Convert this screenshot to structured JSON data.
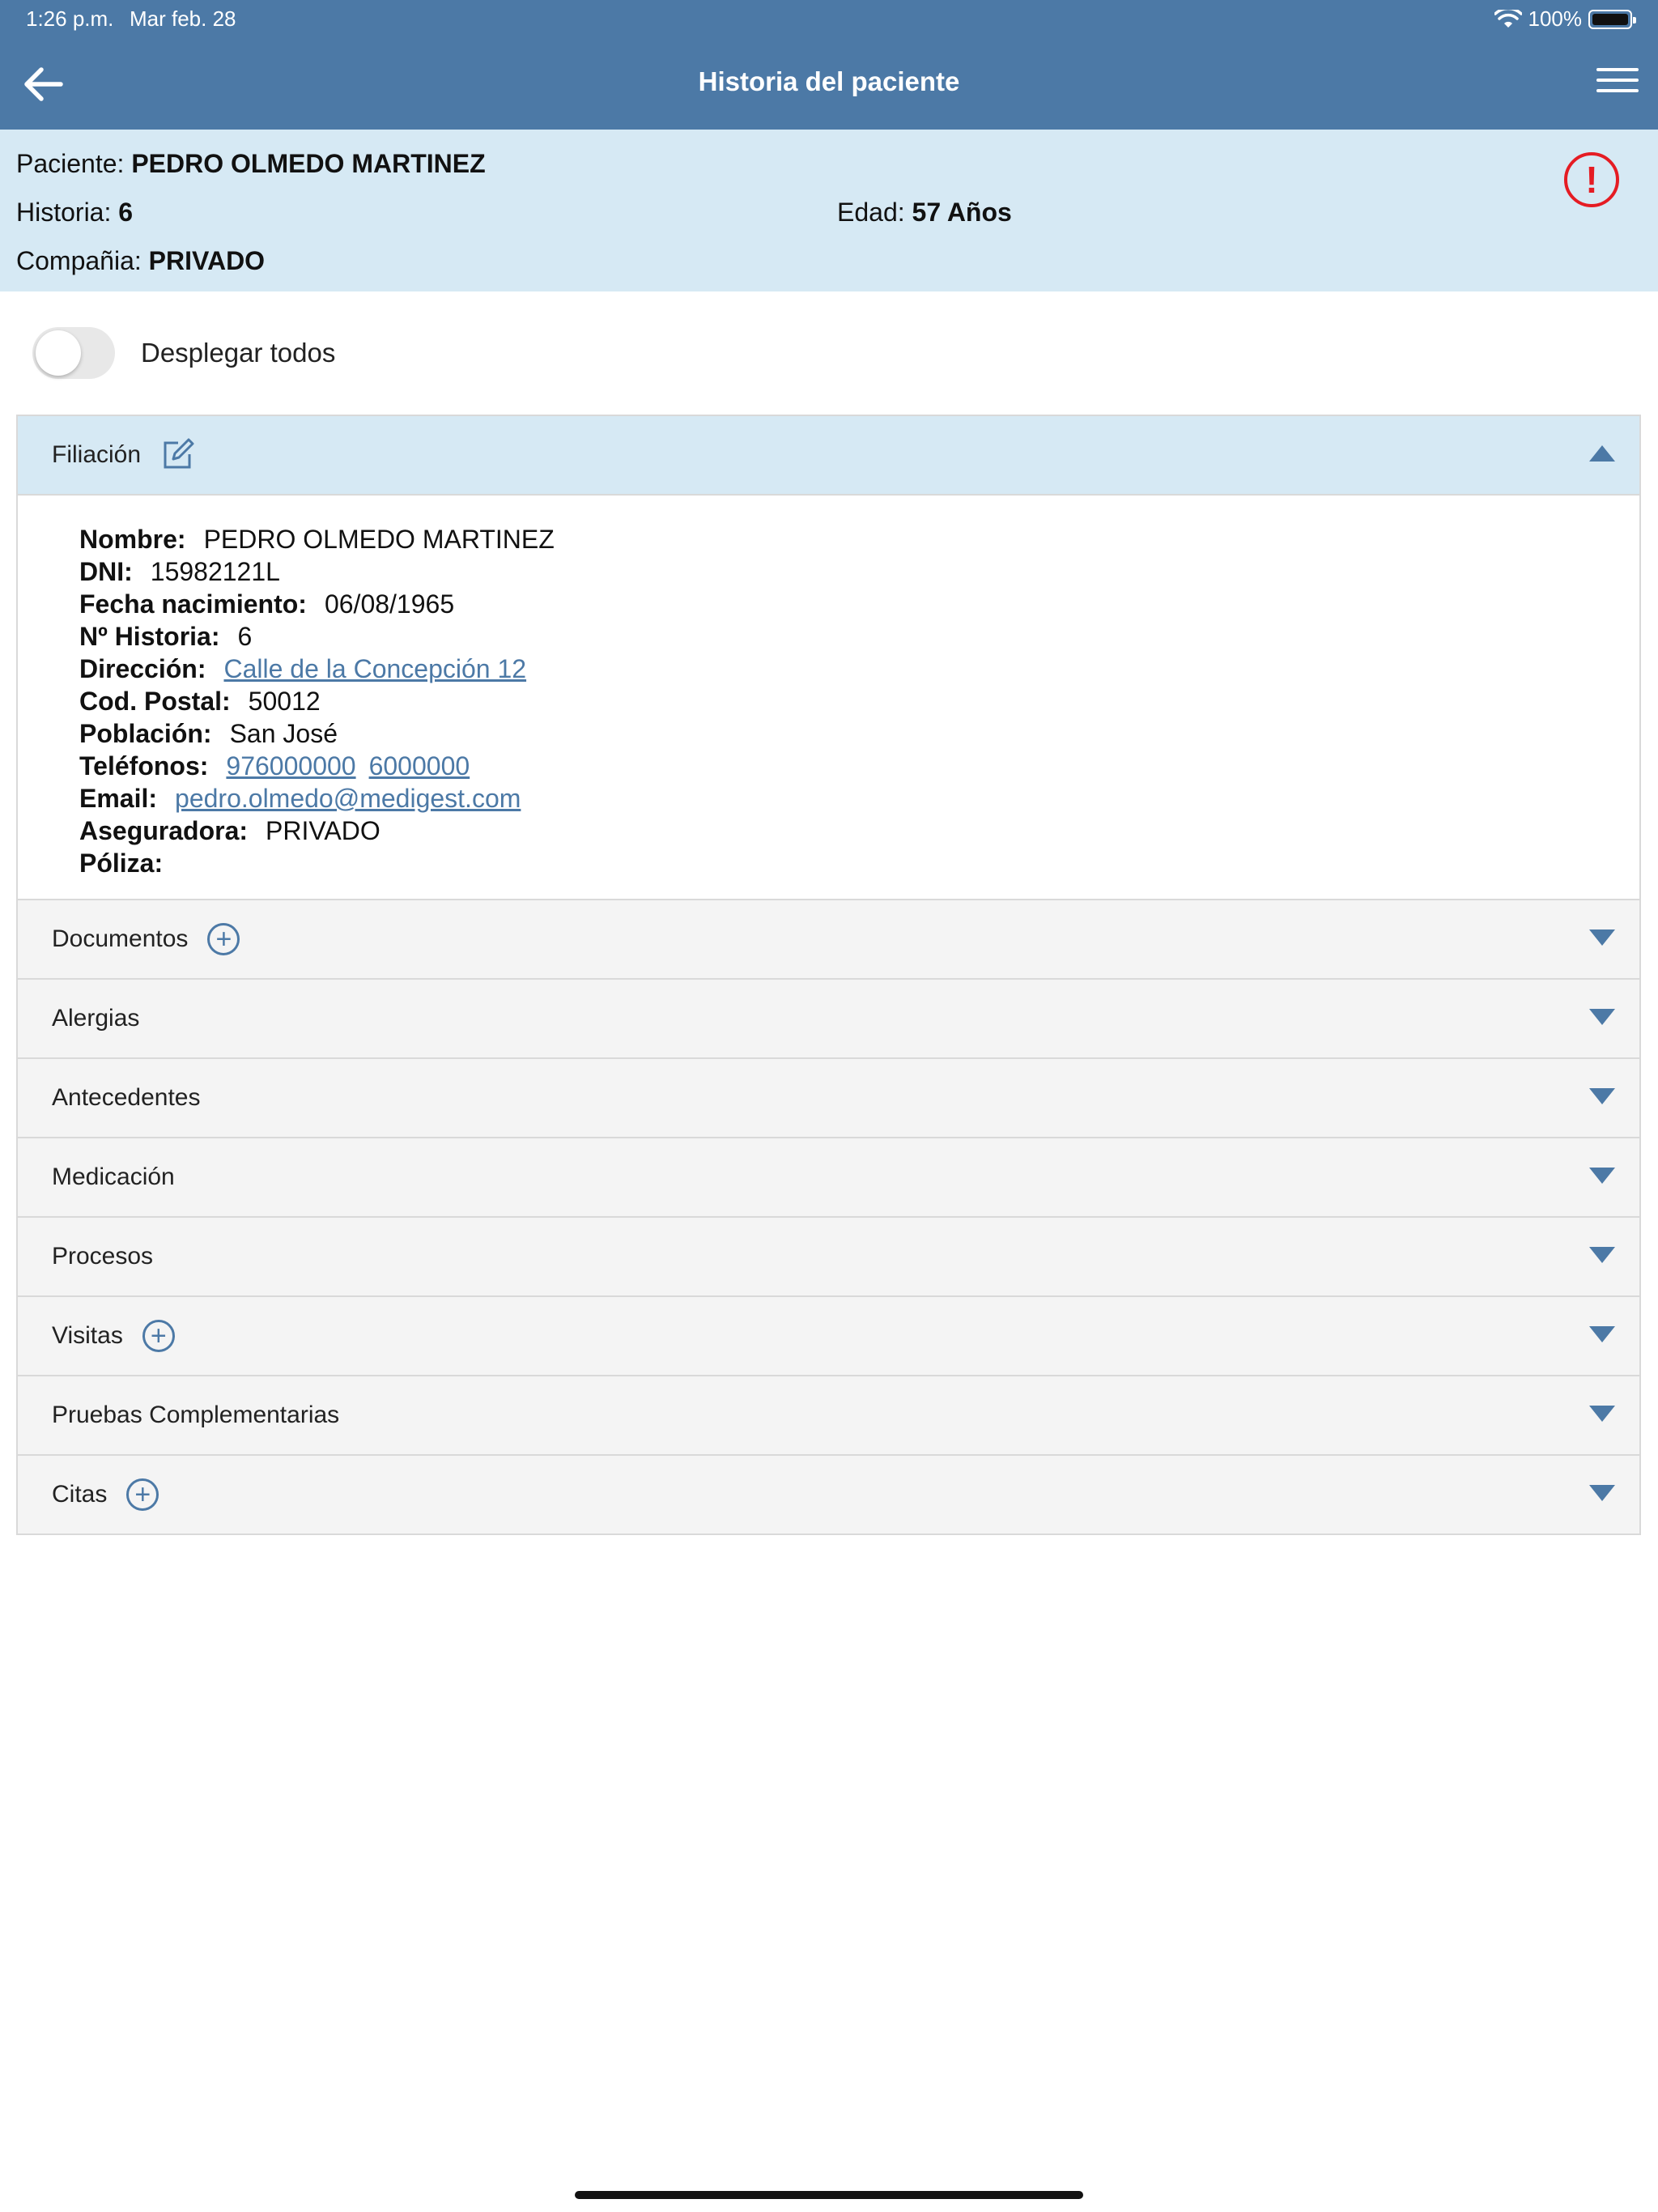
{
  "status_bar": {
    "time": "1:26 p.m.",
    "date": "Mar feb. 28",
    "battery": "100%"
  },
  "nav": {
    "title": "Historia del paciente"
  },
  "patient": {
    "name_label": "Paciente:",
    "name_value": "PEDRO OLMEDO MARTINEZ",
    "history_label": "Historia:",
    "history_value": "6",
    "age_label": "Edad:",
    "age_value": "57 Años",
    "company_label": "Compañia:",
    "company_value": "PRIVADO"
  },
  "toggle": {
    "label": "Desplegar todos"
  },
  "filiacion": {
    "title": "Filiación",
    "fields": {
      "nombre_label": "Nombre:",
      "nombre": "PEDRO OLMEDO MARTINEZ",
      "dni_label": "DNI:",
      "dni": "15982121L",
      "fecha_label": "Fecha nacimiento:",
      "fecha": "06/08/1965",
      "historia_label": "Nº Historia:",
      "historia": "6",
      "direccion_label": "Dirección:",
      "direccion": "Calle de la Concepción 12",
      "cp_label": "Cod. Postal:",
      "cp": "50012",
      "poblacion_label": "Población:",
      "poblacion": "San José",
      "telefonos_label": "Teléfonos:",
      "telefono1": "976000000",
      "telefono2": "6000000",
      "email_label": "Email:",
      "email": "pedro.olmedo@medigest.com",
      "aseguradora_label": "Aseguradora:",
      "aseguradora": "PRIVADO",
      "poliza_label": "Póliza:"
    }
  },
  "sections": {
    "documentos": "Documentos",
    "alergias": "Alergias",
    "antecedentes": "Antecedentes",
    "medicacion": "Medicación",
    "procesos": "Procesos",
    "visitas": "Visitas",
    "pruebas": "Pruebas Complementarias",
    "citas": "Citas"
  },
  "colors": {
    "nav_bg": "#4c79a6",
    "panel_bg": "#d6e9f4",
    "alert": "#e51c23"
  }
}
